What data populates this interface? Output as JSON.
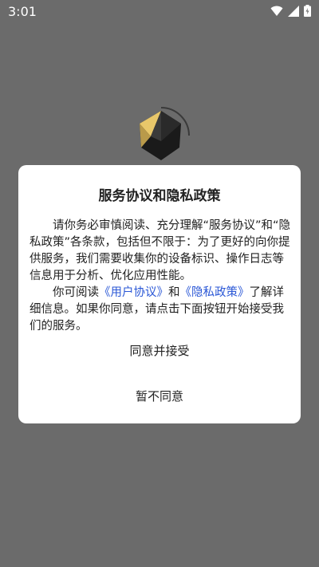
{
  "status_bar": {
    "time": "3:01",
    "icons": [
      "wifi-icon",
      "signal-icon",
      "battery-icon"
    ]
  },
  "app_logo": "black-polyhedron-logo",
  "dialog": {
    "title": "服务协议和隐私政策",
    "paragraph1": "请你务必审慎阅读、充分理解“服务协议”和“隐私政策”各条款，包括但不限于：为了更好的向你提供服务，我们需要收集你的设备标识、操作日志等信息用于分析、优化应用性能。",
    "paragraph2_prefix": "你可阅读",
    "user_agreement_link": "《用户协议》",
    "and_text": "和",
    "privacy_policy_link": "《隐私政策》",
    "paragraph2_suffix": "了解详细信息。如果你同意，请点击下面按钮开始接受我们的服务。",
    "accept_label": "同意并接受",
    "decline_label": "暂不同意",
    "link_color": "#2a57d6"
  }
}
